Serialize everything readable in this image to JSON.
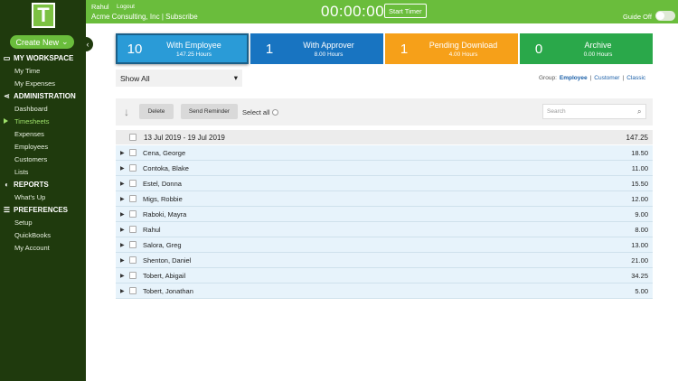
{
  "sidebar": {
    "logo_letter": "T",
    "create_new": "Create New",
    "sections": [
      {
        "label": "MY WORKSPACE",
        "items": [
          "My Time",
          "My Expenses"
        ]
      },
      {
        "label": "ADMINISTRATION",
        "items": [
          "Dashboard",
          "Timesheets",
          "Expenses",
          "Employees",
          "Customers",
          "Lists"
        ]
      },
      {
        "label": "REPORTS",
        "items": [
          "What's Up"
        ]
      },
      {
        "label": "PREFERENCES",
        "items": [
          "Setup",
          "QuickBooks",
          "My Account"
        ]
      }
    ],
    "active_item": "Timesheets"
  },
  "topbar": {
    "user": "Rahul",
    "logout": "Logout",
    "company": "Acme Consulting, Inc | Subscribe",
    "timer": "00:00:00",
    "start_timer": "Start Timer",
    "guide": "Guide Off"
  },
  "status_tabs": [
    {
      "count": "10",
      "title": "With Employee",
      "hours": "147.25 Hours",
      "color": "#2a9bd7"
    },
    {
      "count": "1",
      "title": "With Approver",
      "hours": "8.00 Hours",
      "color": "#1874c1"
    },
    {
      "count": "1",
      "title": "Pending Download",
      "hours": "4.00 Hours",
      "color": "#f6a019"
    },
    {
      "count": "0",
      "title": "Archive",
      "hours": "0.00 Hours",
      "color": "#2aa84a"
    }
  ],
  "filter": {
    "show": "Show All",
    "group_label": "Group:",
    "group_options": [
      "Employee",
      "Customer",
      "Classic"
    ],
    "group_active": "Employee"
  },
  "toolbar": {
    "delete": "Delete",
    "send_reminder": "Send Reminder",
    "select_all": "Select all",
    "search_placeholder": "Search"
  },
  "table": {
    "week": "13 Jul 2019 - 19 Jul 2019",
    "week_total": "147.25",
    "rows": [
      {
        "name": "Cena, George",
        "hours": "18.50"
      },
      {
        "name": "Contoka, Blake",
        "hours": "11.00"
      },
      {
        "name": "Estel, Donna",
        "hours": "15.50"
      },
      {
        "name": "Migs, Robbie",
        "hours": "12.00"
      },
      {
        "name": "Raboki, Mayra",
        "hours": "9.00"
      },
      {
        "name": "Rahul",
        "hours": "8.00"
      },
      {
        "name": "Salora, Greg",
        "hours": "13.00"
      },
      {
        "name": "Shenton, Daniel",
        "hours": "21.00"
      },
      {
        "name": "Tobert, Abigail",
        "hours": "34.25"
      },
      {
        "name": "Tobert, Jonathan",
        "hours": "5.00"
      }
    ]
  }
}
